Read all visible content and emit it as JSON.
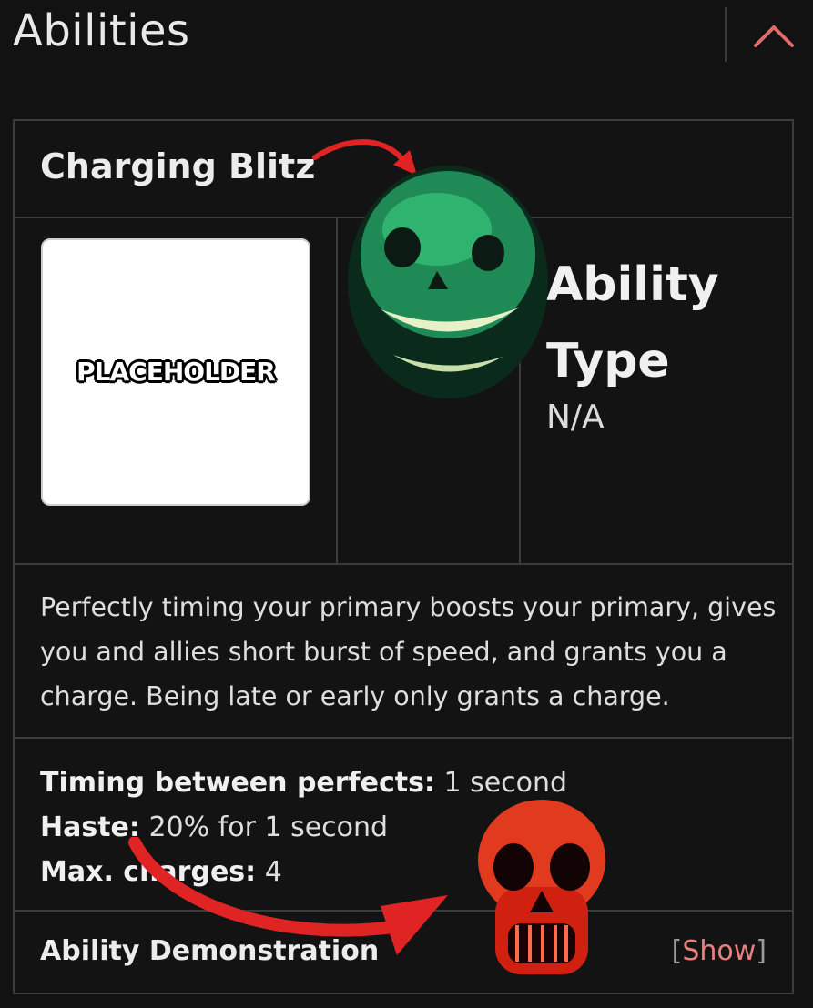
{
  "header": {
    "title": "Abilities",
    "collapse_icon": "chevron-up-icon",
    "accent": "#e36a6a"
  },
  "ability": {
    "name": "Charging Blitz",
    "image_label": "PLACEHOLDER",
    "type_heading_1": "Ability",
    "type_heading_2": "Type",
    "type_value": "N/A",
    "description": "Perfectly timing your primary boosts your primary, gives you and allies short burst of speed, and grants you a charge. Being late or early only grants a charge.",
    "stats": [
      {
        "label": "Timing between perfects:",
        "value": " 1 second"
      },
      {
        "label": "Haste:",
        "value": " 20% for 1 second"
      },
      {
        "label": "Max. charges:",
        "value": " 4"
      }
    ],
    "demo_label": "Ability Demonstration",
    "show_open": "[",
    "show_label": "Show",
    "show_close": "]"
  },
  "overlays": {
    "arrow_color": "#e02424",
    "green_face_icon": "green-grinning-face-icon",
    "red_skull_icon": "red-skull-icon"
  }
}
